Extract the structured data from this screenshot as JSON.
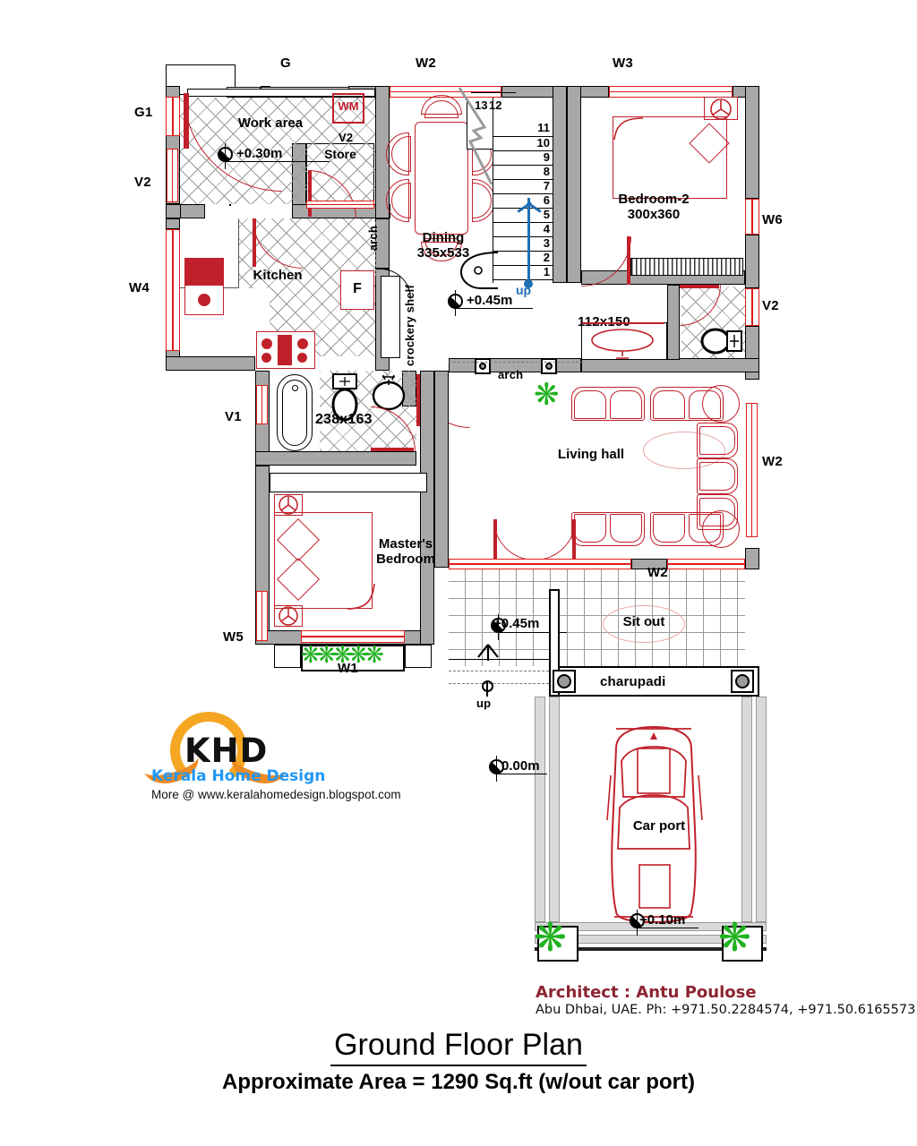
{
  "drawing": {
    "title": "Ground Floor Plan",
    "subtitle": "Approximate Area = 1290 Sq.ft (w/out car port)"
  },
  "architect": {
    "name": "Architect : Antu Poulose",
    "contact": "Abu Dhbai, UAE. Ph: +971.50.2284574, +971.50.6165573"
  },
  "logo": {
    "monogram": "KHD",
    "name": "Kerala Home Design",
    "url": "More @  www.keralahomedesign.blogspot.com"
  },
  "rooms": [
    {
      "name": "Work area",
      "dim": ""
    },
    {
      "name": "Store",
      "dim": ""
    },
    {
      "name": "Kitchen",
      "dim": ""
    },
    {
      "name": "Dining",
      "dim": "335x533"
    },
    {
      "name": "Bedroom-2",
      "dim": "300x360"
    },
    {
      "name": "Master's\nBedroom",
      "dim": ""
    },
    {
      "name": "Living hall",
      "dim": ""
    },
    {
      "name": "Sit out",
      "dim": ""
    },
    {
      "name": "Car port",
      "dim": ""
    }
  ],
  "room_labels": {
    "work_area": "Work area",
    "store": "Store",
    "kitchen": "Kitchen",
    "dining": "Dining",
    "dining_dim": "335x533",
    "bedroom2": "Bedroom-2",
    "bedroom2_dim": "300x360",
    "master_bedroom": "Master's\nBedroom",
    "living_hall": "Living hall",
    "sit_out": "Sit out",
    "car_port": "Car port",
    "bath_main": "238x163",
    "bath_small": "112x150",
    "charupadi": "charupadi",
    "crockery_shelf": "crockery shelf",
    "arch_kitchen": "arch",
    "arch_living": "arch",
    "washing_machine": "WM",
    "fridge": "F"
  },
  "levels": [
    {
      "value": "+0.30m"
    },
    {
      "value": "+0.45m"
    },
    {
      "value": "+0.45m"
    },
    {
      "value": "0.00m"
    },
    {
      "value": "+0.10m"
    }
  ],
  "level_marks": {
    "work_area": "+0.30m",
    "dining": "+0.45m",
    "sit_out": "+0.45m",
    "ground": "0.00m",
    "car_port": "+0.10m"
  },
  "stair": {
    "up_label": "up",
    "up_label_sitout": "up",
    "risers": [
      "1",
      "2",
      "3",
      "4",
      "5",
      "6",
      "7",
      "8",
      "9",
      "10",
      "11"
    ],
    "landing": [
      "13",
      "12"
    ]
  },
  "openings": {
    "top": [
      {
        "id": "G"
      },
      {
        "id": "W2"
      },
      {
        "id": "W3"
      }
    ],
    "left": [
      {
        "id": "G1"
      },
      {
        "id": "V2"
      },
      {
        "id": "W4"
      },
      {
        "id": "V1"
      },
      {
        "id": "W5"
      }
    ],
    "right": [
      {
        "id": "W6"
      },
      {
        "id": "V2"
      },
      {
        "id": "W2"
      }
    ],
    "bottom": [
      {
        "id": "W1"
      },
      {
        "id": "W2"
      }
    ],
    "interior": [
      {
        "id": "V2"
      }
    ]
  },
  "colors": {
    "wall": "#a8a8a8",
    "furniture": "#c0202a",
    "window": "#e01b1b",
    "stair_arrow": "#1f6fb4",
    "plant": "#22b222",
    "logo_orange": "#f5a623",
    "logo_blue": "#2196f3",
    "architect_text": "#8c2432"
  }
}
